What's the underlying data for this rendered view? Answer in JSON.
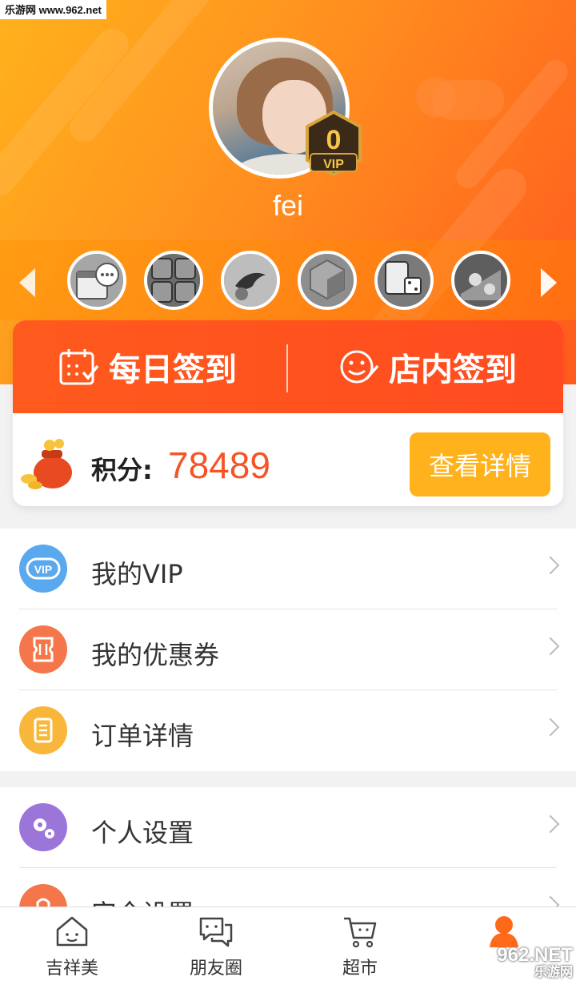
{
  "watermark_top": "乐游网 www.962.net",
  "profile": {
    "username": "fei",
    "vip_level": "0",
    "vip_text": "VIP"
  },
  "games": [
    {
      "icon": "calendar-chat-game-icon"
    },
    {
      "icon": "puzzle-tiles-game-icon"
    },
    {
      "icon": "bird-game-icon"
    },
    {
      "icon": "hexagon-game-icon"
    },
    {
      "icon": "mahjong-dice-game-icon"
    },
    {
      "icon": "chess-game-icon"
    }
  ],
  "sign": {
    "daily_label": "每日签到",
    "store_label": "店内签到"
  },
  "points": {
    "label": "积分:",
    "value": "78489",
    "detail_button": "查看详情"
  },
  "menu_group_1": [
    {
      "label": "我的VIP",
      "icon": "vip-icon",
      "color": "#5aa8ee"
    },
    {
      "label": "我的优惠券",
      "icon": "coupon-icon",
      "color": "#f5764a"
    },
    {
      "label": "订单详情",
      "icon": "order-scroll-icon",
      "color": "#f8b73a"
    }
  ],
  "menu_group_2": [
    {
      "label": "个人设置",
      "icon": "gears-icon",
      "color": "#9b75d8"
    },
    {
      "label": "安全设置",
      "icon": "lock-icon",
      "color": "#f5764a"
    }
  ],
  "bottom_nav": [
    {
      "label": "吉祥美",
      "icon": "home-face-icon"
    },
    {
      "label": "朋友圈",
      "icon": "chat-bubbles-icon"
    },
    {
      "label": "超市",
      "icon": "shopping-cart-icon"
    },
    {
      "label": "",
      "icon": "person-icon",
      "active": true
    }
  ],
  "watermark_bottom": {
    "big": "962.NET",
    "small": "乐游网"
  },
  "colors": {
    "primary": "#ff5a1e",
    "header_start": "#ffb21c",
    "points_value": "#f55526",
    "detail_button": "#ffb21b"
  }
}
